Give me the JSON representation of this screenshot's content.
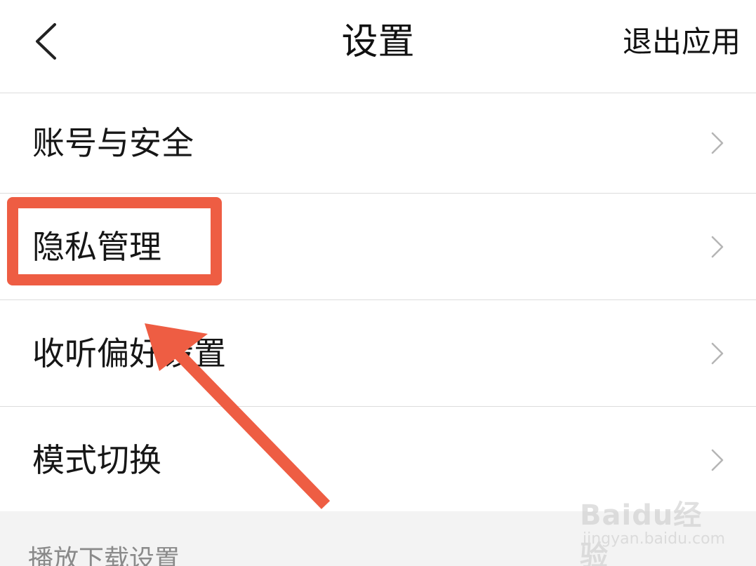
{
  "header": {
    "title": "设置",
    "exit_label": "退出应用",
    "back_icon": "chevron-left-icon"
  },
  "settings_items": [
    {
      "label": "账号与安全",
      "icon": "chevron-right-icon"
    },
    {
      "label": "隐私管理",
      "icon": "chevron-right-icon"
    },
    {
      "label": "收听偏好设置",
      "icon": "chevron-right-icon"
    },
    {
      "label": "模式切换",
      "icon": "chevron-right-icon"
    }
  ],
  "section": {
    "header": "播放下载设置"
  },
  "annotation": {
    "highlight_color": "#ee5d43",
    "highlighted_item": "隐私管理"
  },
  "watermark": {
    "logo": "Baidu经验",
    "url": "jingyan.baidu.com"
  },
  "colors": {
    "background": "#ffffff",
    "divider": "#dcdcdc",
    "text": "#161616",
    "secondary_text": "#8a8a8a",
    "section_bg": "#f3f3f3",
    "chevron": "#b5b5b5",
    "annotation": "#ee5d43"
  }
}
